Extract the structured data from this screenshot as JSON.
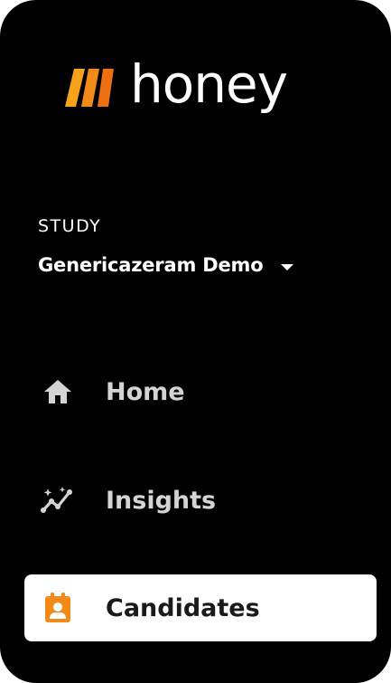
{
  "brand": {
    "name": "honey",
    "accent_color": "#f28a1a",
    "logo_icon": "honey-logo-mark-icon"
  },
  "study": {
    "label": "STUDY",
    "selected": "Genericazeram Demo"
  },
  "nav": {
    "items": [
      {
        "label": "Home",
        "icon": "home-icon",
        "active": false
      },
      {
        "label": "Insights",
        "icon": "insights-icon",
        "active": false
      },
      {
        "label": "Candidates",
        "icon": "candidates-icon",
        "active": true
      }
    ]
  },
  "colors": {
    "background": "#000000",
    "text": "#ffffff",
    "inactive_nav_text": "#d4d4d4",
    "active_nav_bg": "#ffffff",
    "active_nav_text": "#1a1a1a"
  }
}
